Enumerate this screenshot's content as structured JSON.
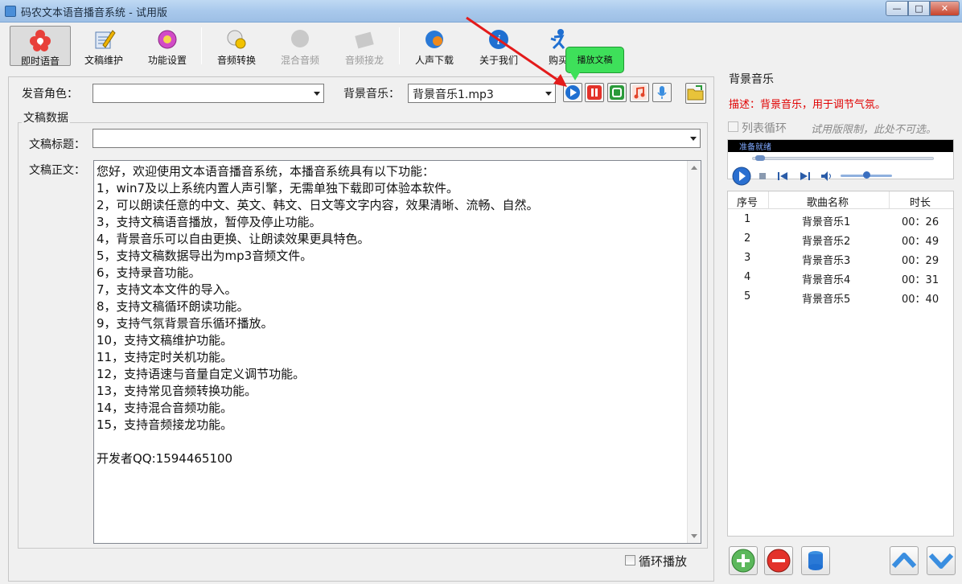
{
  "window": {
    "title": "码农文本语音播音系统 - 试用版",
    "min_glyph": "—",
    "max_glyph": "□",
    "close_glyph": "✕"
  },
  "toolbar": {
    "items": [
      {
        "label": "即时语音",
        "icon": "flower-icon",
        "active": true,
        "disabled": false
      },
      {
        "label": "文稿维护",
        "icon": "edit-document-icon",
        "active": false,
        "disabled": false
      },
      {
        "label": "功能设置",
        "icon": "gear-icon",
        "active": false,
        "disabled": false
      },
      {
        "label": "音频转换",
        "icon": "audio-convert-icon",
        "active": false,
        "disabled": false
      },
      {
        "label": "混合音频",
        "icon": "mix-audio-icon",
        "active": false,
        "disabled": true
      },
      {
        "label": "音频接龙",
        "icon": "audio-chain-icon",
        "active": false,
        "disabled": true
      },
      {
        "label": "人声下载",
        "icon": "voice-download-icon",
        "active": false,
        "disabled": false
      },
      {
        "label": "关于我们",
        "icon": "info-icon",
        "active": false,
        "disabled": false
      },
      {
        "label": "购买",
        "icon": "runner-icon",
        "active": false,
        "disabled": false
      }
    ]
  },
  "voice": {
    "label": "发音角色：",
    "value": ""
  },
  "bgm_select": {
    "label": "背景音乐：",
    "value": "背景音乐1.mp3"
  },
  "playback": {
    "tooltip": "播放文稿",
    "buttons": [
      "play-icon",
      "pause-icon",
      "stop-icon",
      "music-note-icon",
      "microphone-icon",
      "open-folder-icon"
    ]
  },
  "document": {
    "group_title": "文稿数据",
    "title_label": "文稿标题：",
    "title_value": "",
    "body_label": "文稿正文：",
    "body_lines": [
      "您好，欢迎使用文本语音播音系统，本播音系统具有以下功能：",
      "1，win7及以上系统内置人声引擎，无需单独下载即可体验本软件。",
      "2，可以朗读任意的中文、英文、韩文、日文等文字内容，效果清晰、流畅、自然。",
      "3，支持文稿语音播放，暂停及停止功能。",
      "4，背景音乐可以自由更换、让朗读效果更具特色。",
      "5，支持文稿数据导出为mp3音频文件。",
      "6，支持录音功能。",
      "7，支持文本文件的导入。",
      "8，支持文稿循环朗读功能。",
      "9，支持气氛背景音乐循环播放。",
      "10，支持文稿维护功能。",
      "11，支持定时关机功能。",
      "12，支持语速与音量自定义调节功能。",
      "13，支持常见音频转换功能。",
      "14，支持混合音频功能。",
      "15，支持音频接龙功能。",
      "",
      "开发者QQ:1594465100"
    ],
    "loop_label": "循环播放",
    "loop_checked": false
  },
  "bgm_panel": {
    "title": "背景音乐",
    "description": "描述：背景音乐，用于调节气氛。",
    "list_loop_label": "列表循环",
    "list_loop_checked": false,
    "trial_note": "试用版限制，此处不可选。",
    "player_status": "准备就绪",
    "columns": [
      "序号",
      "歌曲名称",
      "时长"
    ],
    "songs": [
      {
        "index": "1",
        "name": "背景音乐1",
        "duration": "00：26"
      },
      {
        "index": "2",
        "name": "背景音乐2",
        "duration": "00：49"
      },
      {
        "index": "3",
        "name": "背景音乐3",
        "duration": "00：29"
      },
      {
        "index": "4",
        "name": "背景音乐4",
        "duration": "00：31"
      },
      {
        "index": "5",
        "name": "背景音乐5",
        "duration": "00：40"
      }
    ],
    "actions": [
      "add-icon",
      "remove-icon",
      "database-icon",
      "move-up-icon",
      "move-down-icon"
    ]
  },
  "colors": {
    "accent_red": "#e00000",
    "tooltip_green": "#3ee05a",
    "arrow_red": "#e31b1b",
    "play_blue": "#1f6fd1"
  }
}
